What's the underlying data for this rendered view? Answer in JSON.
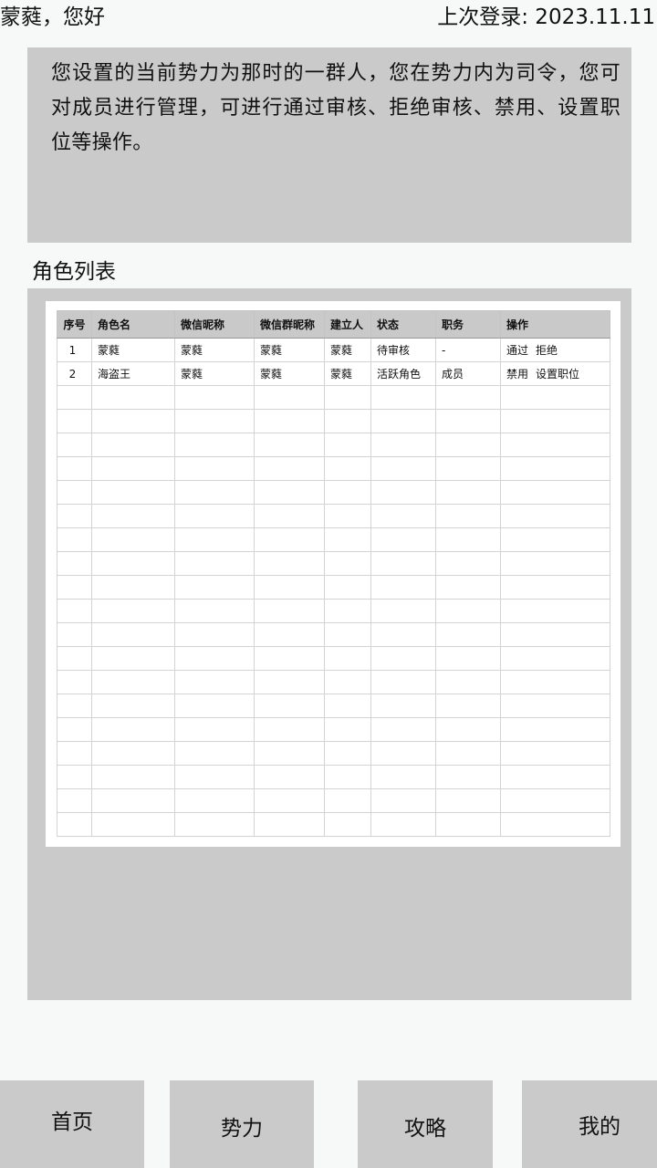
{
  "header": {
    "greeting": "蒙蕤，您好",
    "last_login": "上次登录: 2023.11.11"
  },
  "notice": {
    "text": "您设置的当前势力为那时的一群人，您在势力内为司令，您可对成员进行管理，可进行通过审核、拒绝审核、禁用、设置职位等操作。"
  },
  "roles": {
    "title": "角色列表",
    "columns": [
      "序号",
      "角色名",
      "微信昵称",
      "微信群昵称",
      "建立人",
      "状态",
      "职务",
      "操作"
    ],
    "rows": [
      {
        "index": "1",
        "name": "蒙蕤",
        "wechat_nick": "蒙蕤",
        "group_nick": "蒙蕤",
        "creator": "蒙蕤",
        "status": "待审核",
        "position": "-",
        "actions": [
          "通过",
          "拒绝"
        ]
      },
      {
        "index": "2",
        "name": "海盗王",
        "wechat_nick": "蒙蕤",
        "group_nick": "蒙蕤",
        "creator": "蒙蕤",
        "status": "活跃角色",
        "position": "成员",
        "actions": [
          "禁用",
          "设置职位"
        ]
      }
    ]
  },
  "nav": {
    "items": [
      "首页",
      "势力",
      "攻略",
      "我的"
    ]
  }
}
